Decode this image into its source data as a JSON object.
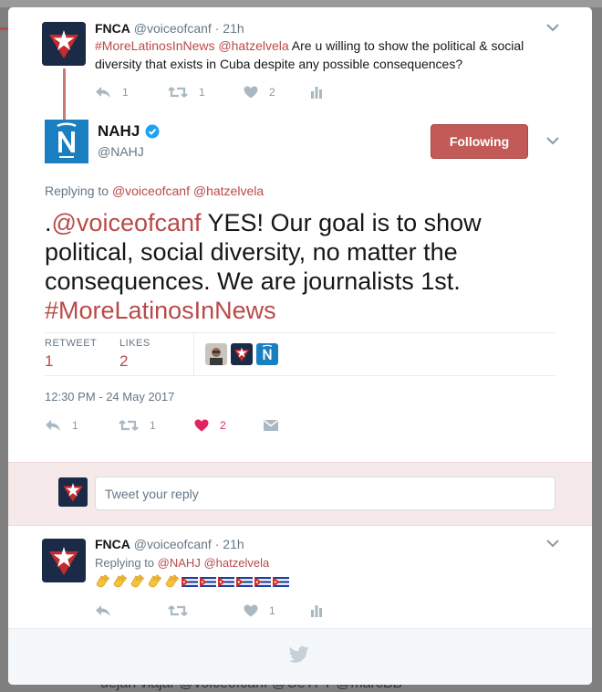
{
  "backdrop": {
    "bottom_text": "dejan viajar @voiceofcanf @CeTI-T @marcBB",
    "accent_color": "#b94a48"
  },
  "parent_tweet": {
    "name": "FNCA",
    "handle": "@voiceofcanf",
    "time": "21h",
    "hashtag": "#MoreLatinosInNews",
    "mention": "@hatzelvela",
    "text": "Are u willing to show the political & social diversity that exists in Cuba despite any possible consequences?",
    "actions": {
      "replies": "1",
      "retweets": "1",
      "likes": "2"
    }
  },
  "main_tweet": {
    "name": "NAHJ",
    "verified": true,
    "handle": "@NAHJ",
    "follow_label": "Following",
    "replying_prefix": "Replying to",
    "replying_to": [
      "@voiceofcanf",
      "@hatzelvela"
    ],
    "text_prefix": ".",
    "text_mention": "@voiceofcanf",
    "text_body": " YES! Our goal is to show political, social diversity, no matter the consequences. We are journalists 1st. ",
    "text_hashtag": "#MoreLatinosInNews",
    "stats": {
      "retweet_label": "RETWEET",
      "retweet_count": "1",
      "likes_label": "LIKES",
      "likes_count": "2"
    },
    "datetime": "12:30 PM - 24 May 2017",
    "actions": {
      "replies": "1",
      "retweets": "1",
      "likes": "2"
    },
    "liked": true
  },
  "reply_box": {
    "placeholder": "Tweet your reply"
  },
  "reply_tweet": {
    "name": "FNCA",
    "handle": "@voiceofcanf",
    "time": "21h",
    "replying_prefix": "Replying to",
    "replying_to": [
      "@NAHJ",
      "@hatzelvela"
    ],
    "emoji": [
      "clapping-hands",
      "clapping-hands",
      "clapping-hands",
      "clapping-hands",
      "clapping-hands",
      "cuba-flag",
      "cuba-flag",
      "cuba-flag",
      "cuba-flag",
      "cuba-flag",
      "cuba-flag"
    ],
    "actions": {
      "likes": "1"
    }
  },
  "icons": {
    "reply": "reply-icon",
    "retweet": "retweet-icon",
    "like": "heart-icon",
    "analytics": "analytics-icon",
    "dm": "envelope-icon",
    "more": "chevron-down-icon",
    "footer": "twitter-bird-icon"
  }
}
